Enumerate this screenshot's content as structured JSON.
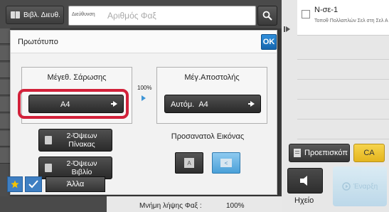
{
  "top": {
    "address_book_label": "Βιβλ. Διευθ.",
    "address_label": "Διεύθυνση",
    "search_placeholder": "Αριθμός Φαξ"
  },
  "right_panel": {
    "entry_name": "N-σε-1",
    "entry_sub": "Τοποθ Πολλαπλών Σελ στη Σελ Α",
    "preview_label": "Προεπισκόπ",
    "ca_label": "CA",
    "speaker_label": "Ηχείο",
    "start_label": "Έναρξη"
  },
  "dialog": {
    "title": "Πρωτότυπο",
    "ok_label": "OK",
    "scan_size": {
      "label": "Μέγεθ. Σάρωσης",
      "value": "A4"
    },
    "send_size": {
      "label": "Μέγ.Αποστολής",
      "value": "Αυτόμ.  A4"
    },
    "ratio": "100%",
    "duplex_tablet": {
      "line1": "2-Όψεων",
      "line2": "Πίνακας"
    },
    "duplex_book": {
      "line1": "2-Όψεων",
      "line2": "Βιβλίο"
    },
    "orientation_label": "Προσανατολ Εικόνας"
  },
  "bottom": {
    "other_label": "Άλλα",
    "memory_label": "Μνήμη λήψης Φαξ :",
    "memory_value": "100%"
  },
  "colors": {
    "highlight": "#d2213a",
    "accent_blue": "#1766ad",
    "ca_yellow": "#e4b51e"
  }
}
